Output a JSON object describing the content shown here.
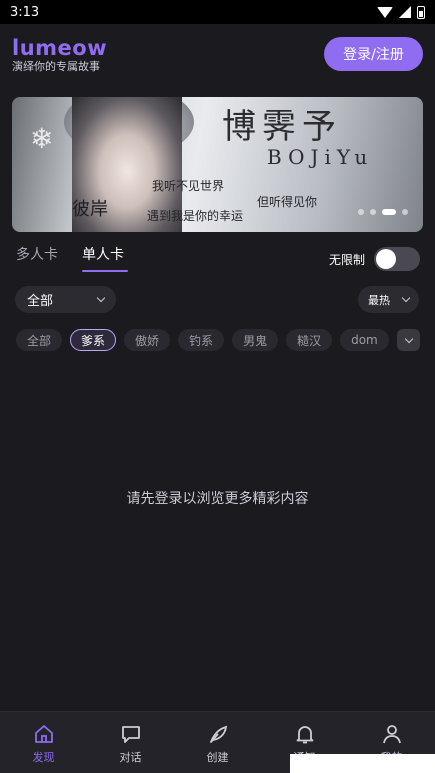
{
  "status_bar": {
    "time": "3:13",
    "icons": [
      "wifi-icon",
      "signal-icon",
      "battery-icon"
    ]
  },
  "header": {
    "logo": "lumeow",
    "subtitle": "演绎你的专属故事",
    "login_button": "登录/注册"
  },
  "banner": {
    "title_chars": "博霁予",
    "latin": "BOJiYu",
    "line1": "我听不见世界",
    "line2": "但听得见你",
    "line3": "遇到我是你的幸运",
    "signature": "彼岸",
    "slide_count": 4,
    "active_slide": 3
  },
  "tabs": {
    "items": [
      "多人卡",
      "单人卡"
    ],
    "active_index": 1
  },
  "toggle": {
    "label": "无限制",
    "on": false
  },
  "filters": {
    "category_selected": "全部",
    "sort_selected": "最热"
  },
  "chips": {
    "items": [
      "全部",
      "爹系",
      "傲娇",
      "钓系",
      "男鬼",
      "糙汉",
      "dom"
    ],
    "active_index": 1
  },
  "empty_message": "请先登录以浏览更多精彩内容",
  "bottom_nav": {
    "items": [
      {
        "label": "发现",
        "icon": "home-icon"
      },
      {
        "label": "对话",
        "icon": "chat-icon"
      },
      {
        "label": "创建",
        "icon": "feather-icon"
      },
      {
        "label": "通知",
        "icon": "bell-icon"
      },
      {
        "label": "我的",
        "icon": "person-icon"
      }
    ],
    "active_index": 0
  },
  "colors": {
    "accent": "#8f6cf0",
    "background": "#1b1a1f",
    "nav_background": "#242329"
  }
}
